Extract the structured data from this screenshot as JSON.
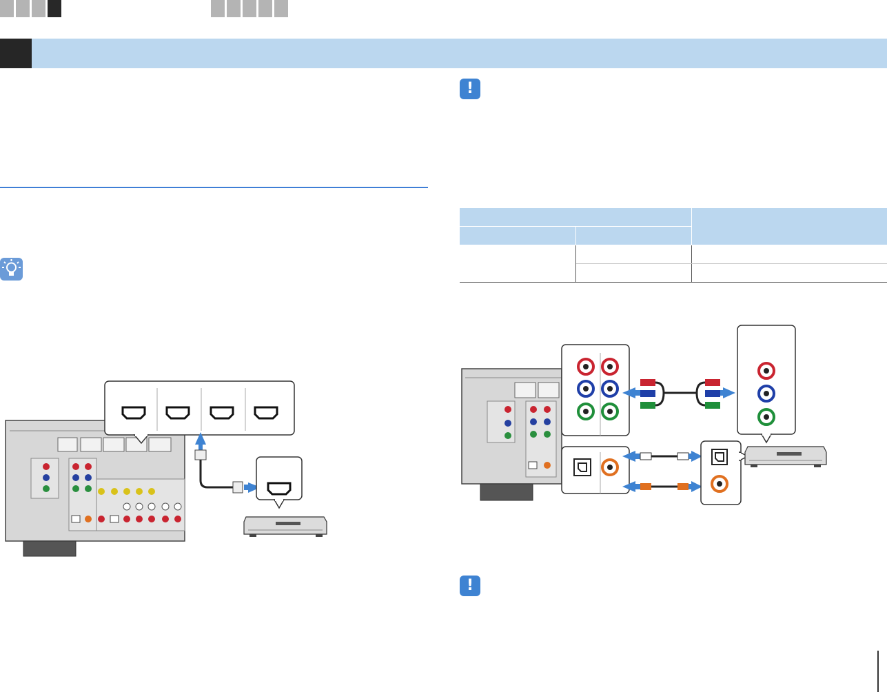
{
  "nav": {
    "group1_count": 4,
    "group1_active": 4,
    "group2_count": 5
  },
  "section": {
    "title": ""
  },
  "icons": {
    "note": "exclamation-icon",
    "hint": "lightbulb-icon"
  },
  "spec_table": {
    "header_row1": [
      "",
      ""
    ],
    "header_row2": [
      "",
      ""
    ],
    "rows": [
      [
        "",
        "",
        ""
      ],
      [
        "",
        ""
      ]
    ]
  },
  "colors": {
    "accent_blue": "#3e83d2",
    "section_bar": "#bbd7ef",
    "rule": "#3f7ed6",
    "component_red": "#d9202a",
    "component_blue": "#1f3fa8",
    "component_green": "#1f8f3a",
    "coaxial_orange": "#e07020"
  }
}
